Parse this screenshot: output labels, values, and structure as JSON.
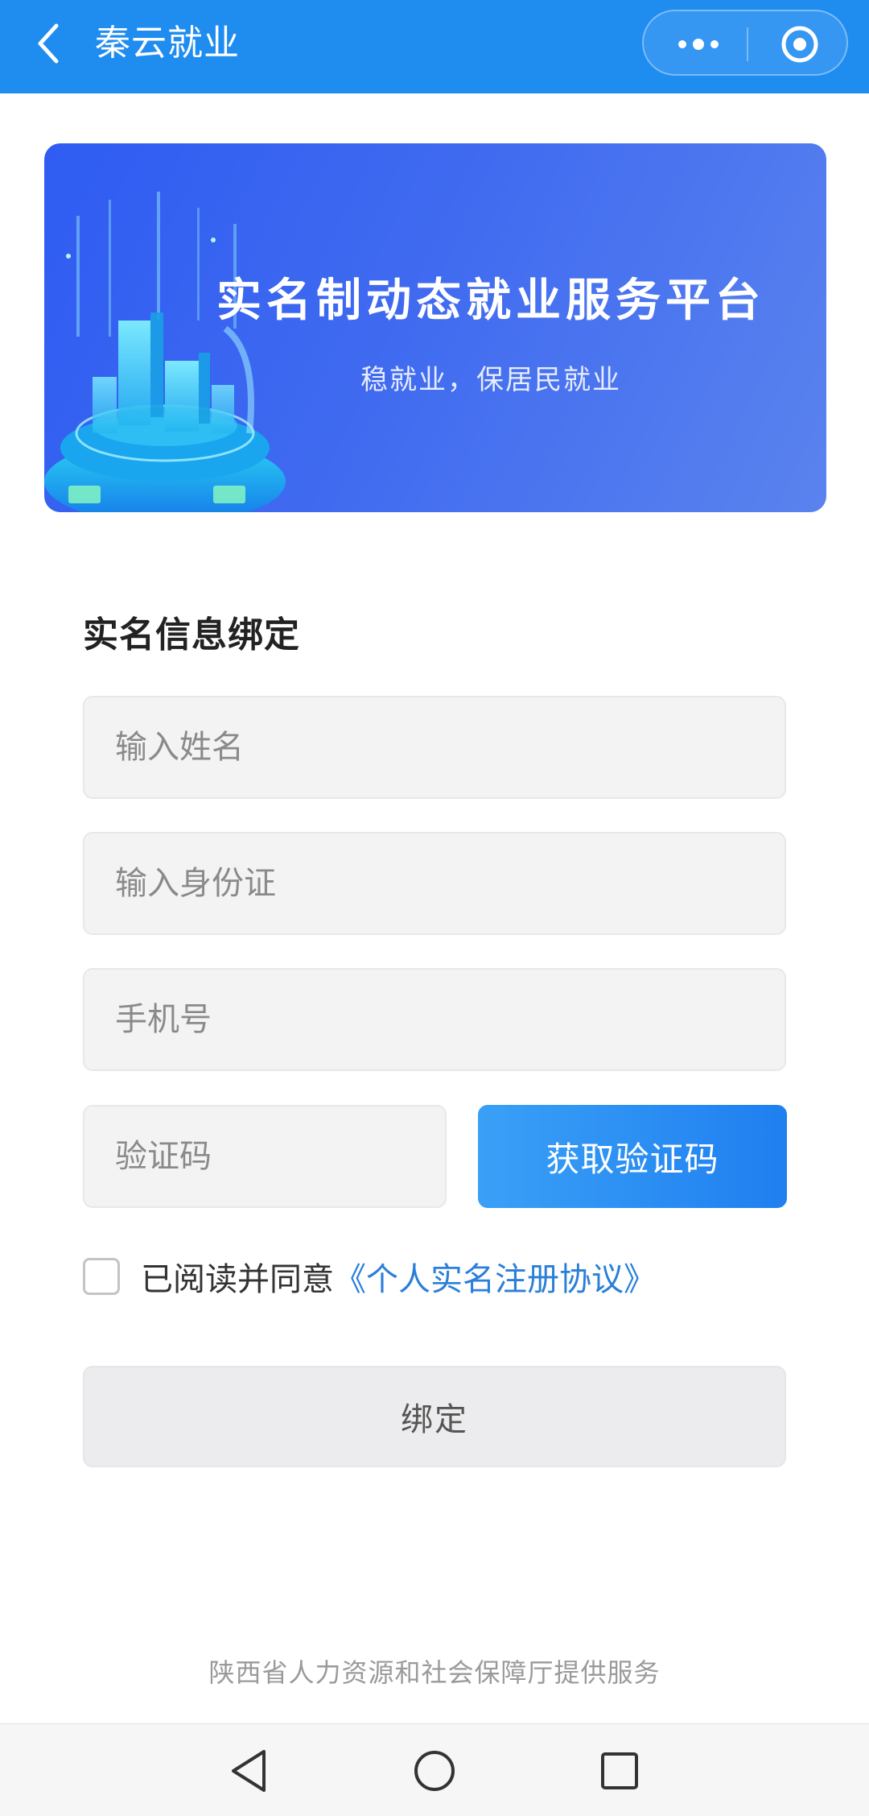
{
  "topbar": {
    "title": "秦云就业",
    "back_icon": "chevron-left-icon",
    "more_icon": "more-dots-icon",
    "target_icon": "target-icon",
    "color": "#1f8cf0"
  },
  "banner": {
    "title": "实名制动态就业服务平台",
    "subtitle": "稳就业，保居民就业",
    "color_start": "#2f5cf2",
    "color_end": "#5a83ee"
  },
  "form": {
    "section_title": "实名信息绑定",
    "name_placeholder": "输入姓名",
    "id_placeholder": "输入身份证",
    "phone_placeholder": "手机号",
    "code_placeholder": "验证码",
    "get_code_label": "获取验证码",
    "agree_prefix": "已阅读并同意",
    "agree_link": "《个人实名注册协议》",
    "agree_checked": false,
    "bind_label": "绑定",
    "accent_color": "#1f7ff0",
    "link_color": "#2a7fd8"
  },
  "footer": {
    "text": "陕西省人力资源和社会保障厅提供服务"
  },
  "navbar": {
    "back_icon": "triangle-back-icon",
    "home_icon": "circle-home-icon",
    "recent_icon": "square-recent-icon"
  }
}
